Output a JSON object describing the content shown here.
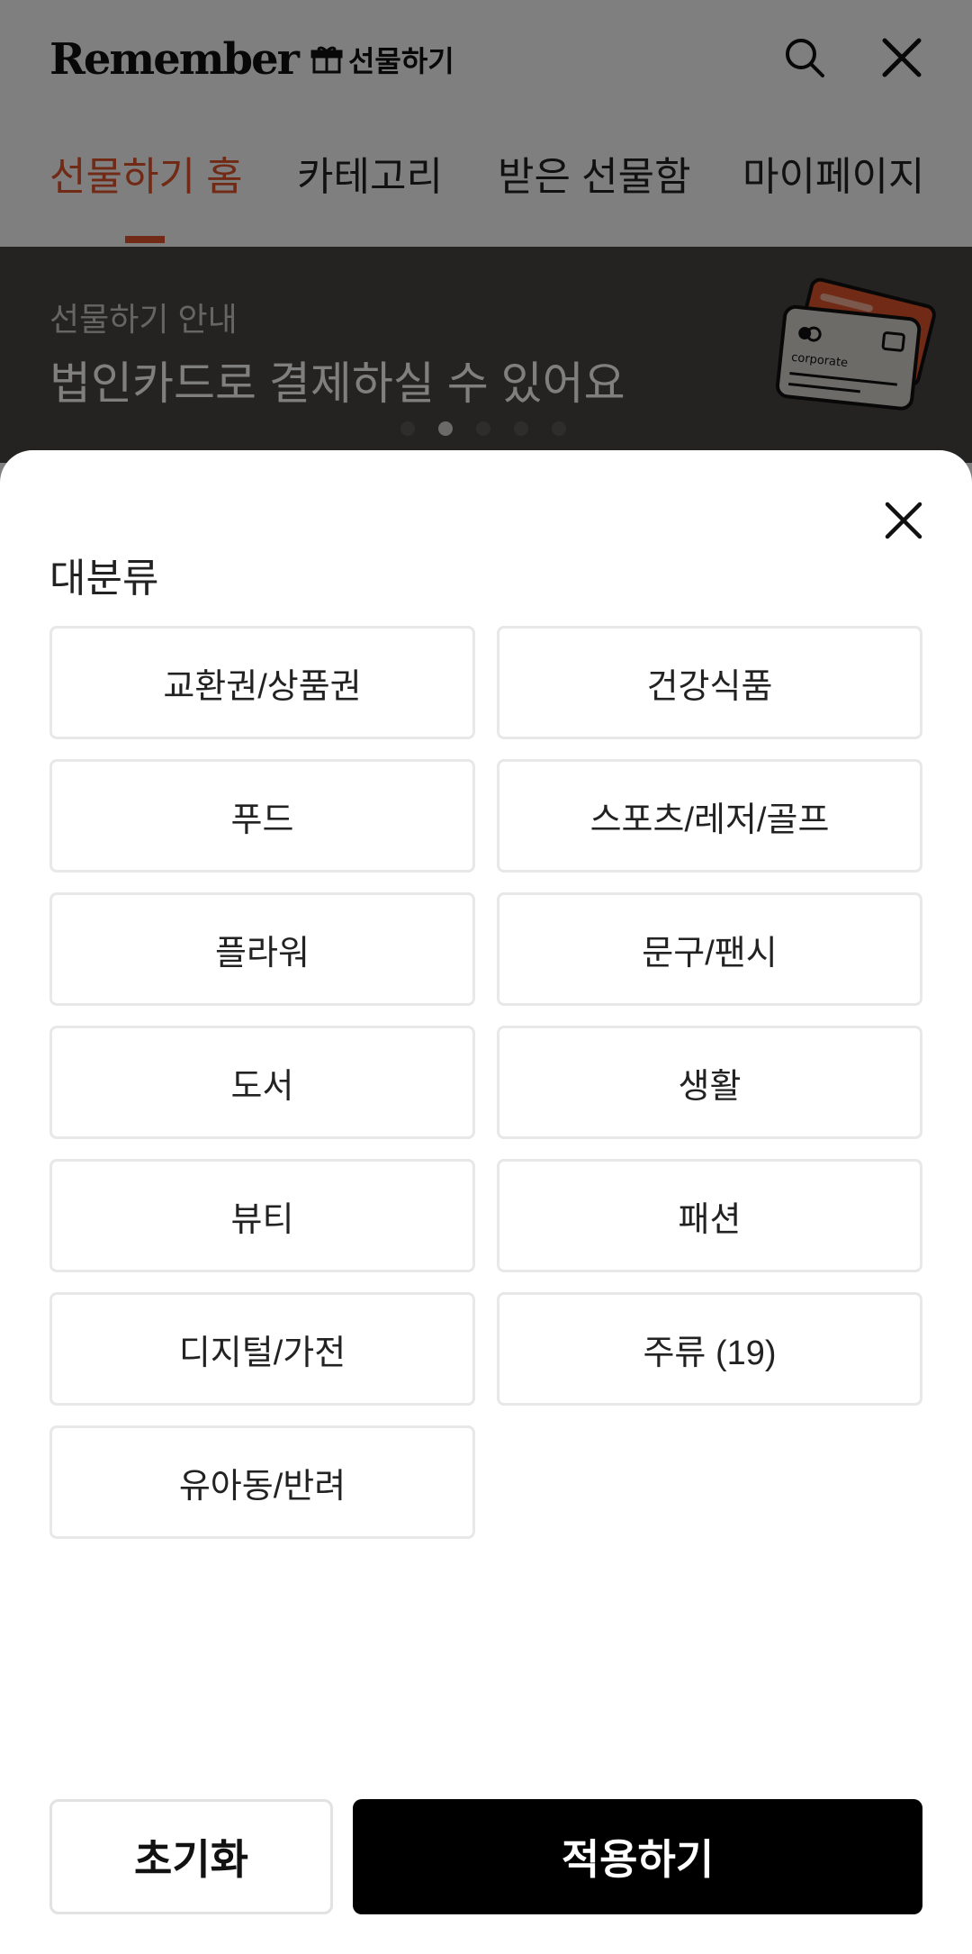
{
  "header": {
    "logo_text": "Remember",
    "logo_sub": "선물하기",
    "icons": [
      "gift-icon",
      "search-icon",
      "close-icon"
    ]
  },
  "tabs": [
    {
      "label": "선물하기 홈",
      "active": true
    },
    {
      "label": "카테고리",
      "active": false
    },
    {
      "label": "받은 선물함",
      "active": false
    },
    {
      "label": "마이페이지",
      "active": false
    }
  ],
  "banner": {
    "kicker": "선물하기 안내",
    "title": "법인카드로 결제하실 수 있어요",
    "card_text": "corporate",
    "page_count": 5,
    "active_page": 2
  },
  "sheet": {
    "title": "대분류",
    "categories": [
      "교환권/상품권",
      "건강식품",
      "푸드",
      "스포츠/레저/골프",
      "플라워",
      "문구/팬시",
      "도서",
      "생활",
      "뷰티",
      "패션",
      "디지털/가전",
      "주류 (19)",
      "유아동/반려"
    ],
    "reset_label": "초기화",
    "apply_label": "적용하기"
  },
  "colors": {
    "accent": "#e0552a",
    "banner_bg": "#4a4744",
    "primary_button": "#000000",
    "scrim": "rgba(0,0,0,0.5)"
  }
}
